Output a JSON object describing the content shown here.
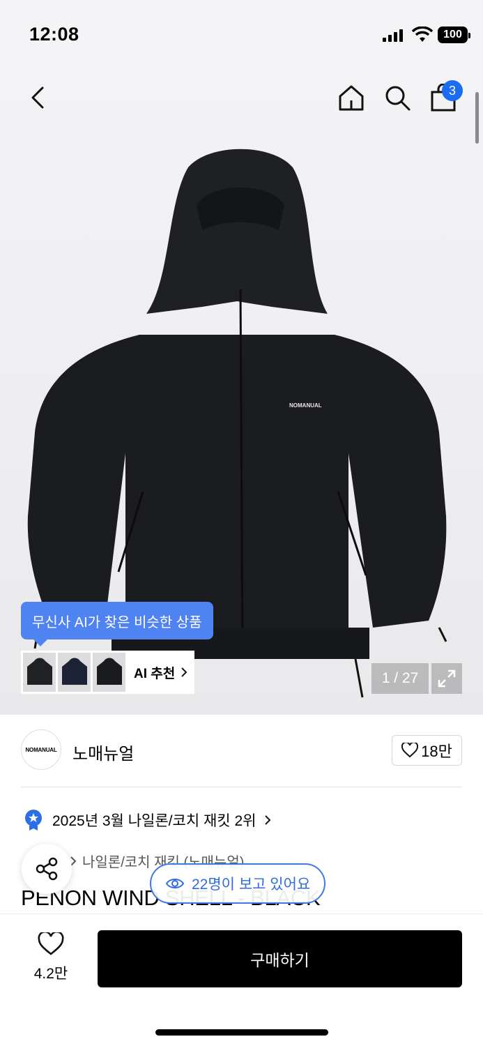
{
  "status": {
    "time": "12:08",
    "battery": "100"
  },
  "nav": {
    "cart_count": "3"
  },
  "product_image": {
    "logo_text": "NOMANUAL"
  },
  "ai": {
    "tooltip": "무신사 AI가 찾은 비슷한 상품",
    "label": "AI 추천"
  },
  "gallery": {
    "counter": "1 / 27"
  },
  "brand": {
    "logo_text": "NOMANUAL",
    "name": "노매뉴얼",
    "likes": "18만"
  },
  "ranking": {
    "text": "2025년 3월 나일론/코치 재킷 2위"
  },
  "category": {
    "text": "나일론/코치 재킷 (노매뉴얼)"
  },
  "product": {
    "title": "PENON WIND SHELL - BLACK"
  },
  "viewers": {
    "text": "22명이 보고 있어요"
  },
  "bottom": {
    "wish_count": "4.2만",
    "buy_label": "구매하기"
  },
  "colors": {
    "accent": "#1a6cf0",
    "pill": "#3d78e8",
    "tooltip": "#4f83f2"
  }
}
